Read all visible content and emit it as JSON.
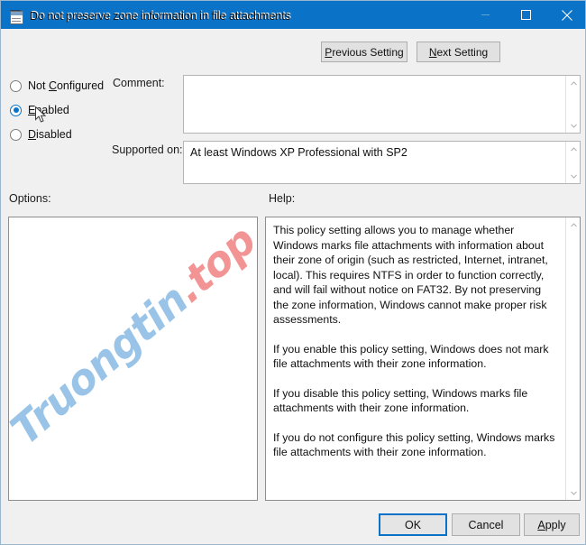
{
  "window": {
    "title": "Do not preserve zone information in file attachments",
    "title_icon": "computer-policy-icon",
    "controls": {
      "minimize": "minimize-icon",
      "maximize": "maximize-icon",
      "close": "close-icon"
    },
    "accent_color": "#0a73c8",
    "titlebar_color": "#0a73c8",
    "background_color": "#f0f0f0"
  },
  "header": {
    "policy_icon": "policy-setting-icon",
    "policy_title": "Do not preserve zone information in file attachments",
    "previous_button": "Previous Setting",
    "previous_accel": "P",
    "next_button": "Next Setting",
    "next_accel": "N"
  },
  "state_options": [
    {
      "label": "Not Configured",
      "accel": "C",
      "pre": "Not ",
      "post": "onfigured",
      "checked": false
    },
    {
      "label": "Enabled",
      "accel": "E",
      "pre": "",
      "post": "nabled",
      "checked": true
    },
    {
      "label": "Disabled",
      "accel": "D",
      "pre": "",
      "post": "isabled",
      "checked": false
    }
  ],
  "comment": {
    "label": "Comment:",
    "value": "",
    "placeholder": ""
  },
  "supported": {
    "label": "Supported on:",
    "value": "At least Windows XP Professional with SP2"
  },
  "options": {
    "label": "Options:",
    "content": ""
  },
  "help": {
    "label": "Help:",
    "paragraphs": [
      "This policy setting allows you to manage whether Windows marks file attachments with information about their zone of origin (such as restricted, Internet, intranet, local). This requires NTFS in order to function correctly, and will fail without notice on FAT32. By not preserving the zone information, Windows cannot make proper risk assessments.",
      "If you enable this policy setting, Windows does not mark file attachments with their zone information.",
      "If you disable this policy setting, Windows marks file attachments with their zone information.",
      "If you do not configure this policy setting, Windows marks file attachments with their zone information."
    ]
  },
  "footer": {
    "ok": "OK",
    "cancel": "Cancel",
    "apply": "Apply",
    "apply_accel": "A",
    "default_button": "OK"
  },
  "watermark": {
    "name": "Truongtin",
    "tld": ".top",
    "name_color": "#74aede",
    "tld_color": "#ef6b6b"
  }
}
